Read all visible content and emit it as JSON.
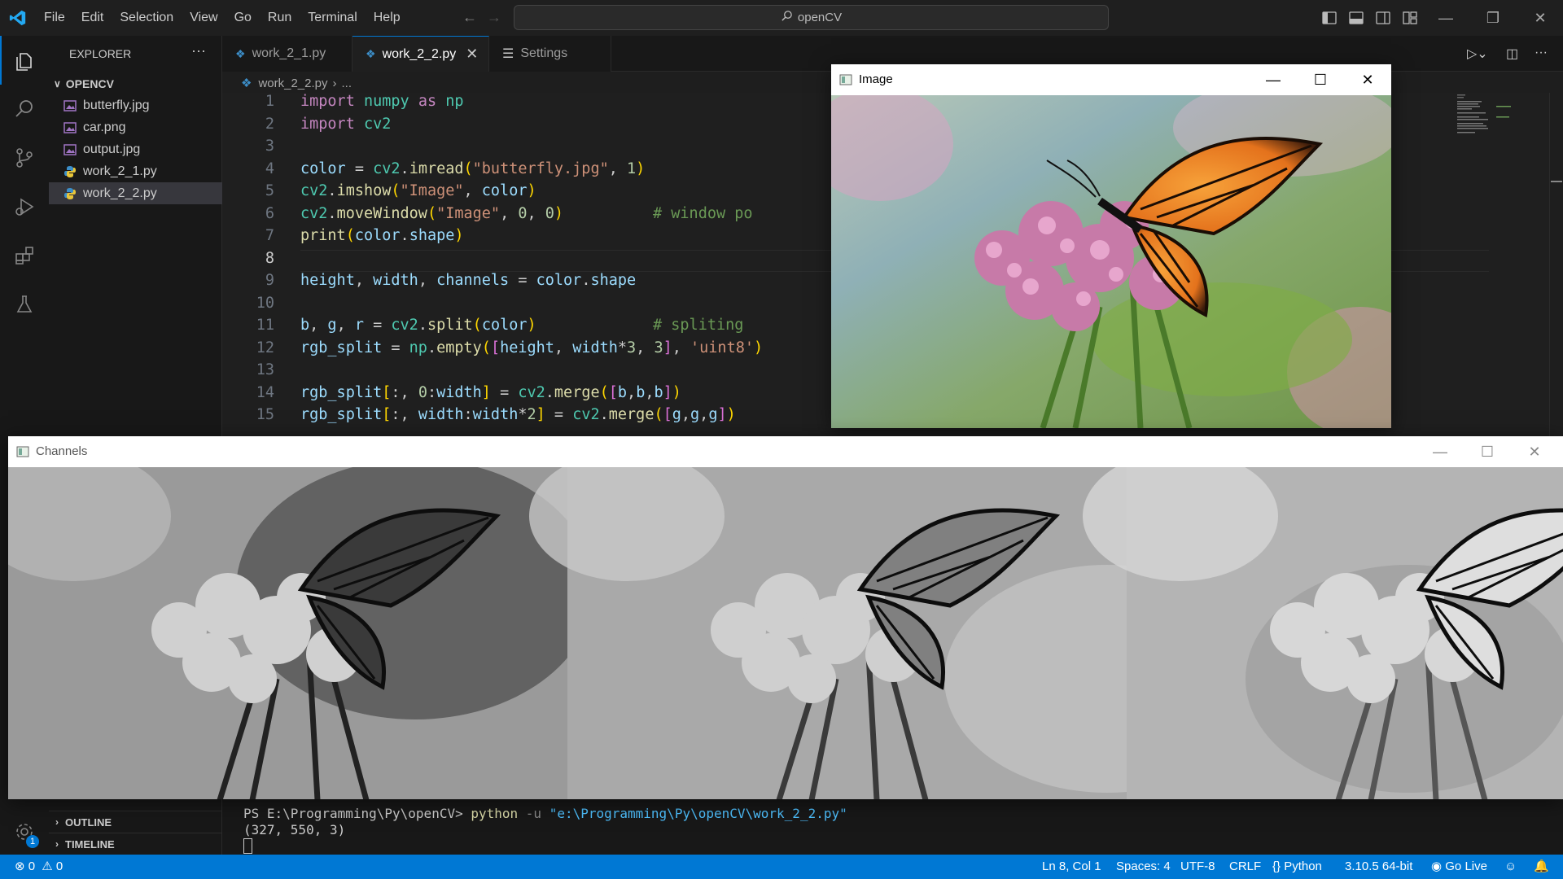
{
  "menubar": {
    "items": [
      "File",
      "Edit",
      "Selection",
      "View",
      "Go",
      "Run",
      "Terminal",
      "Help"
    ],
    "search": "openCV"
  },
  "explorer": {
    "title": "EXPLORER",
    "more": "···",
    "folder": "OPENCV",
    "files": [
      {
        "name": "butterfly.jpg",
        "type": "image"
      },
      {
        "name": "car.png",
        "type": "image"
      },
      {
        "name": "output.jpg",
        "type": "image"
      },
      {
        "name": "work_2_1.py",
        "type": "python"
      },
      {
        "name": "work_2_2.py",
        "type": "python",
        "selected": true
      }
    ],
    "outline": "OUTLINE",
    "timeline": "TIMELINE"
  },
  "tabs": [
    {
      "label": "work_2_1.py",
      "active": false
    },
    {
      "label": "work_2_2.py",
      "active": true
    },
    {
      "label": "Settings",
      "active": false
    }
  ],
  "breadcrumb": {
    "file": "work_2_2.py",
    "rest": "..."
  },
  "editor": {
    "current_line": 8,
    "line_numbers": [
      "1",
      "2",
      "3",
      "4",
      "5",
      "6",
      "7",
      "8",
      "9",
      "10",
      "11",
      "12",
      "13",
      "14",
      "15"
    ],
    "comments": {
      "line6": "# window po",
      "line11": "# spliting"
    }
  },
  "terminal": {
    "prompt": "PS E:\\Programming\\Py\\openCV> ",
    "command": "python",
    "flag": " -u ",
    "path": "\"e:\\Programming\\Py\\openCV\\work_2_2.py\"",
    "output": "(327, 550, 3)"
  },
  "statusbar": {
    "errors": "0",
    "warnings": "0",
    "position": "Ln 8, Col 1",
    "spaces": "Spaces: 4",
    "encoding": "UTF-8",
    "eol": "CRLF",
    "language": "Python",
    "interpreter": "3.10.5 64-bit",
    "golive": "Go Live",
    "notif_count": "1"
  },
  "windows": {
    "image": {
      "title": "Image"
    },
    "channels": {
      "title": "Channels"
    }
  },
  "colors": {
    "accent": "#0078d4",
    "background": "#1e1e1e"
  }
}
